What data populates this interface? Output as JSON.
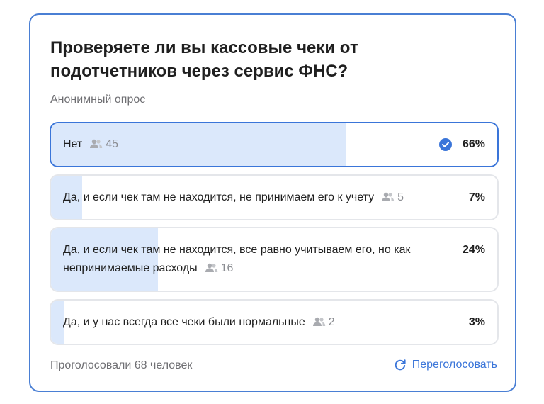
{
  "poll": {
    "title": "Проверяете ли вы кассовые чеки от подотчетников через сервис ФНС?",
    "subtitle": "Анонимный опрос",
    "options": [
      {
        "label": "Нет",
        "voters": "45",
        "percent": "66%",
        "selected": true
      },
      {
        "label": "Да, и если чек там не находится, не принимаем его к учету",
        "voters": "5",
        "percent": "7%",
        "selected": false
      },
      {
        "label": "Да, и если чек там не находится, все равно учитываем его, но как непринимаемые расходы",
        "voters": "16",
        "percent": "24%",
        "selected": false
      },
      {
        "label": "Да, и у нас всегда все чеки были нормальные",
        "voters": "2",
        "percent": "3%",
        "selected": false
      }
    ],
    "total_votes": "Проголосовали 68 человек",
    "revote_label": "Переголосовать"
  },
  "colors": {
    "accent": "#3a75d9",
    "bar_fill": "#dbe8fb",
    "border": "#e4e6ea"
  },
  "icons": {
    "voters": "people-icon",
    "selected": "check-circle-icon",
    "revote": "refresh-icon"
  }
}
